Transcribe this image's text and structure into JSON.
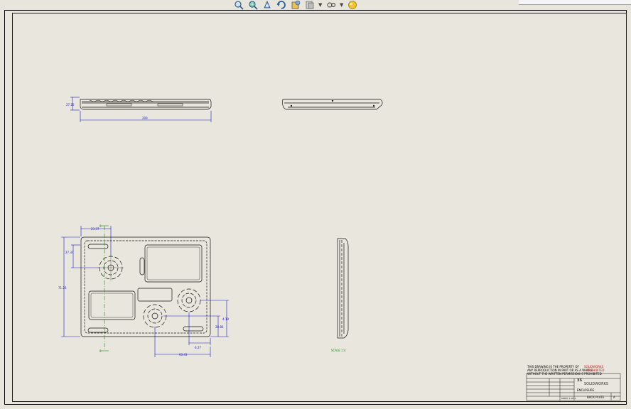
{
  "toolbar": {
    "icons": [
      "zoom-to-fit-icon",
      "zoom-area-icon",
      "pan-icon",
      "redraw-icon",
      "display-style-icon",
      "hide-show-icon",
      "view-settings-icon",
      "appearance-icon"
    ]
  },
  "views": {
    "top_view": {
      "dim_height": "27.20",
      "dim_width": "209"
    },
    "front_view": {
      "dim_top_width": "23.37",
      "dim_left_height": "27.37",
      "dim_overall_height": "71.26",
      "dim_right_1": "4.19",
      "dim_right_2": "20.86",
      "dim_bottom_1": "6.27",
      "dim_bottom_2": "63.43",
      "centerline_label": "0"
    },
    "side_view": {
      "label": "SCALE 1:4"
    }
  },
  "title_block": {
    "note_line_1": "THIS DRAWING IS THE PROPERTY OF",
    "note_red_1": "SOLIDWORKS",
    "note_line_2": "ANY REPRODUCTION IN PART OR AS A WHOLE",
    "note_red_2": "PROHIBITED",
    "note_line_3": "WITHOUT THE WRITTEN PERMISSION IS PROHIBITED",
    "brand": "SOLIDWORKS",
    "brand_mark": "3S",
    "part_name": "ENCLOSURE",
    "drawing_no": "BACK PLATE",
    "size": "A",
    "sheet": "SHEET 1 OF 1"
  },
  "colors": {
    "sheet_bg": "#e9e7dd",
    "dimension": "#1414c8",
    "centerline": "#1a8a1a",
    "geometry": "#111111"
  }
}
